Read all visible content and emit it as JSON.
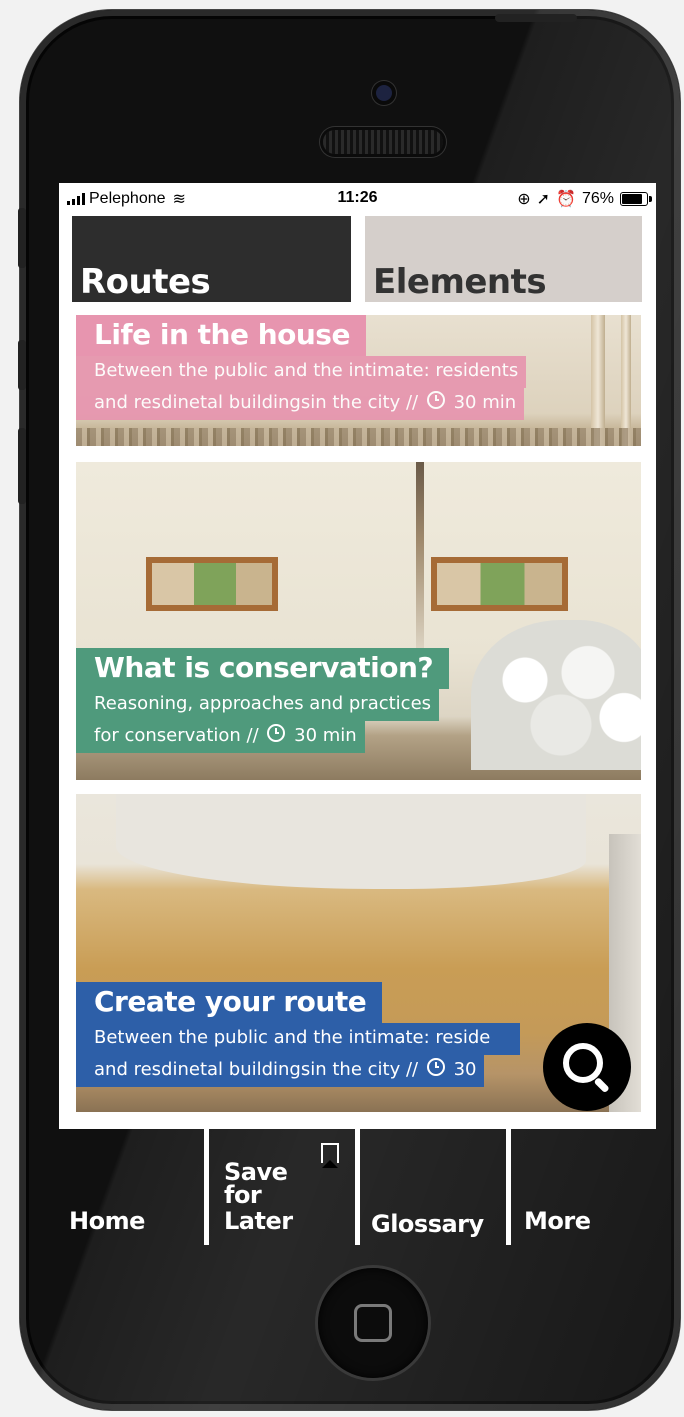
{
  "status_bar": {
    "carrier": "Pelephone",
    "time": "11:26",
    "battery": "76%",
    "battery_level": 0.76,
    "icons": [
      "signal-bars-icon",
      "wifi-icon",
      "rotation-lock-icon",
      "location-arrow-icon",
      "alarm-icon",
      "battery-icon"
    ]
  },
  "tabs": [
    {
      "label": "Routes",
      "selected": true
    },
    {
      "label": "Elements",
      "selected": false
    }
  ],
  "cards": [
    {
      "title": "Life in the house",
      "subtitle_line1": "Between the public and the intimate: residents",
      "subtitle_line2": "and resdinetal buildingsin the city //",
      "duration": "30 min",
      "color": "#e795af"
    },
    {
      "title": "What is conservation?",
      "subtitle_line1": "Reasoning, approaches and practices",
      "subtitle_line2": "for conservation  //",
      "duration": "30 min",
      "color": "#4f9a7c"
    },
    {
      "title": "Create your route",
      "subtitle_line1": "Between the public and the intimate: reside",
      "subtitle_line2": "and resdinetal buildingsin the city //",
      "duration": "30",
      "color": "#2d5fa8"
    }
  ],
  "fab": {
    "icon": "search-icon"
  },
  "nav": {
    "home": "Home",
    "save_line1": "Save",
    "save_line2": "for",
    "save_line3": "Later",
    "glossary": "Glossary",
    "more": "More",
    "save_icon": "bookmark-icon"
  }
}
